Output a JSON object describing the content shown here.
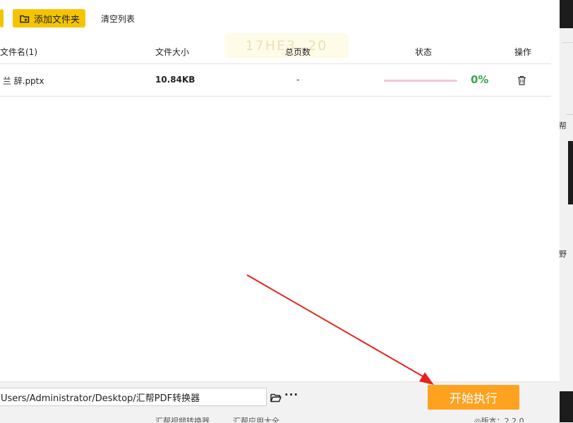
{
  "toolbar": {
    "add_folder_label": "添加文件夹",
    "clear_list_label": "清空列表"
  },
  "watermark": {
    "text": "17HE3..20"
  },
  "table": {
    "columns": {
      "name": "文件名(1)",
      "size": "文件大小",
      "pages": "总页数",
      "status": "状态",
      "action": "操作"
    },
    "rows": [
      {
        "name": "木兰辞.pptx",
        "name_visible": " 兰 辞.pptx",
        "size": "10.84KB",
        "pages": "-",
        "progress": 0,
        "progress_text": "0%"
      }
    ]
  },
  "right_edge": {
    "label_1": "帮",
    "label_2": "野"
  },
  "output": {
    "path_value": "Users/Administrator/Desktop/汇帮PDF转换器",
    "more_label": "···",
    "start_label": "开始执行"
  },
  "footer": {
    "link_1": "汇帮视频转换器",
    "link_2": "汇帮应用大全",
    "version": "◎版本：2.2.0"
  },
  "colors": {
    "accent_yellow": "#f5c400",
    "start_orange": "#ffa21f",
    "progress_pink": "#f6c7d3",
    "progress_text_green": "#3aa24a",
    "annotation_red": "#e8231c"
  },
  "icons": {
    "add_folder": "folder-plus-icon",
    "delete": "trash-icon",
    "browse": "folder-open-icon"
  }
}
